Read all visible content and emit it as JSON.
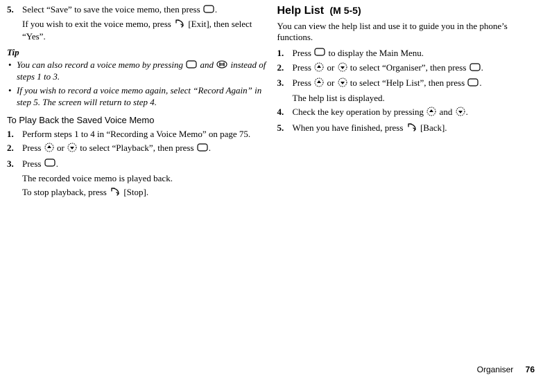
{
  "left": {
    "step5": {
      "num": "5.",
      "line1a": "Select “Save” to save the voice memo, then press ",
      "line1b": ".",
      "line2a": "If you wish to exit the voice memo, press ",
      "line2b": " [Exit], then select “Yes”."
    },
    "tip_head": "Tip",
    "tip1a": "You can also record a voice memo by pressing ",
    "tip1b": " and ",
    "tip1c": " instead of steps 1 to 3.",
    "tip2": "If you wish to record a voice memo again, select “Record Again” in step 5. The screen will return to step 4.",
    "subhead": "To Play Back the Saved Voice Memo",
    "pb1": {
      "num": "1.",
      "text": "Perform steps 1 to 4 in “Recording a Voice Memo” on page 75."
    },
    "pb2": {
      "num": "2.",
      "a": "Press ",
      "b": " or ",
      "c": " to select “Playback”, then press ",
      "d": "."
    },
    "pb3": {
      "num": "3.",
      "a": "Press ",
      "b": ".",
      "line2": "The recorded voice memo is played back.",
      "line3a": "To stop playback, press ",
      "line3b": " [Stop]."
    }
  },
  "right": {
    "heading": "Help List",
    "menu": "(M 5-5)",
    "intro": "You can view the help list and use it to guide you in the phone’s functions.",
    "s1": {
      "num": "1.",
      "a": "Press ",
      "b": " to display the Main Menu."
    },
    "s2": {
      "num": "2.",
      "a": "Press ",
      "b": " or ",
      "c": " to select “Organiser”, then press ",
      "d": "."
    },
    "s3": {
      "num": "3.",
      "a": "Press ",
      "b": " or ",
      "c": " to select “Help List”, then press ",
      "d": ".",
      "line2": "The help list is displayed."
    },
    "s4": {
      "num": "4.",
      "a": "Check the key operation by pressing ",
      "b": " and ",
      "c": "."
    },
    "s5": {
      "num": "5.",
      "a": "When you have finished, press ",
      "b": " [Back]."
    }
  },
  "footer": {
    "section": "Organiser",
    "page": "76"
  }
}
